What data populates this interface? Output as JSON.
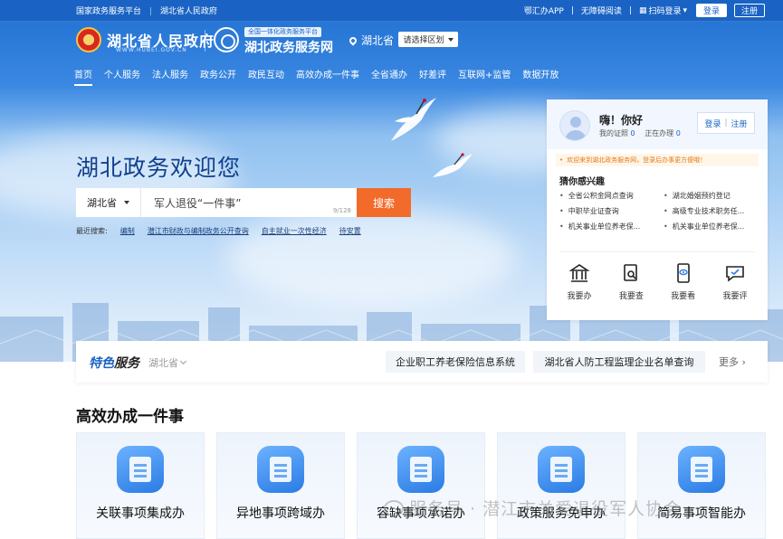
{
  "topbar": {
    "left_links": [
      "国家政务服务平台",
      "湖北省人民政府"
    ],
    "right_links": [
      "鄂汇办APP",
      "无障碍阅读",
      "扫码登录"
    ],
    "login": "登录",
    "register": "注册"
  },
  "header": {
    "gov_name": "湖北省人民政府",
    "gov_url": "WWW.HUBEI.GOV.CN",
    "service_tag": "全国一体化政务服务平台",
    "service_name": "湖北政务服务网",
    "location": "湖北省",
    "region_select": "请选择区划"
  },
  "nav": [
    "首页",
    "个人服务",
    "法人服务",
    "政务公开",
    "政民互动",
    "高效办成一件事",
    "全省通办",
    "好差评",
    "互联网+监管",
    "数据开放"
  ],
  "hero": {
    "title": "湖北政务欢迎您",
    "province": "湖北省",
    "search_value": "军人退役“一件事”",
    "char_count": "9/128",
    "search_button": "搜索",
    "recent_label": "最近搜索:",
    "recent_items": [
      "编制",
      "潜江市财政与编制政务公开查询",
      "自主就业一次性经济",
      "待安置"
    ]
  },
  "panel": {
    "greeting": "嗨！你好",
    "cert_label": "我的证照",
    "cert_count": "0",
    "doing_label": "正在办理",
    "doing_count": "0",
    "login": "登录",
    "register": "注册",
    "notice": "欢迎来到湖北政务服务网，登录后办事更方便哦！",
    "guess_title": "猜你感兴趣",
    "guess_items": [
      "全省公积金网点查询",
      "湖北婚姻预约登记",
      "中职毕业证查询",
      "高级专业技术职务任...",
      "机关事业单位养老保...",
      "机关事业单位养老保..."
    ],
    "quick": [
      "我要办",
      "我要查",
      "我要看",
      "我要评"
    ]
  },
  "features": {
    "title_a": "特色",
    "title_b": "服务",
    "province": "湖北省",
    "items": [
      "企业职工养老保险信息系统",
      "湖北省人防工程监理企业名单查询"
    ],
    "more": "更多 ›"
  },
  "section": {
    "title": "高效办成一件事",
    "cards": [
      "关联事项集成办",
      "异地事项跨域办",
      "容缺事项承诺办",
      "政策服务免申办",
      "简易事项智能办"
    ]
  },
  "watermark": "服务号 · 潜江市关爱退役军人协会"
}
